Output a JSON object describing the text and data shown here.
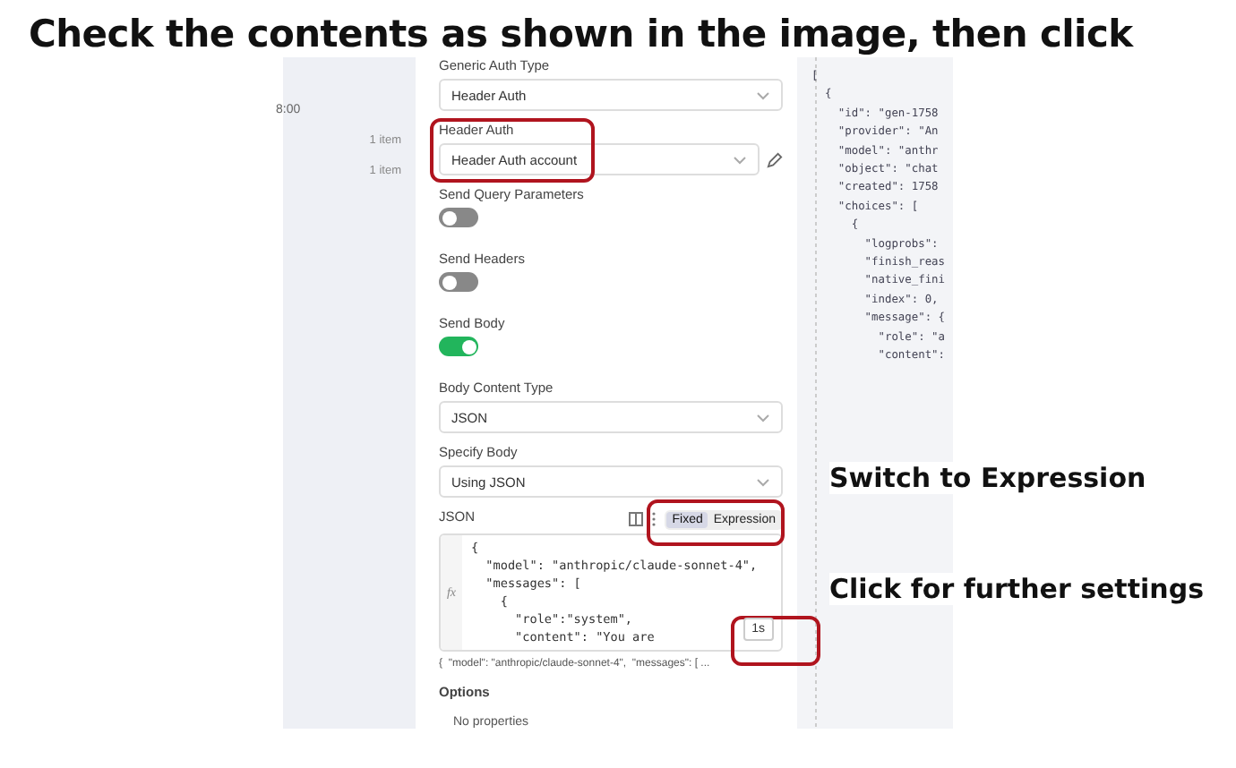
{
  "heading": "Check the contents as shown in the image, then click",
  "left_column": {
    "time": "8:00",
    "items": [
      "1 item",
      "1 item"
    ]
  },
  "fields": [
    {
      "kind": "select",
      "label": "Generic Auth Type",
      "value": "Header Auth"
    },
    {
      "kind": "credential",
      "label": "Header Auth",
      "value": "Header Auth account"
    },
    {
      "kind": "toggle",
      "label": "Send Query Parameters",
      "checked": false
    },
    {
      "kind": "toggle",
      "label": "Send Headers",
      "checked": false
    },
    {
      "kind": "toggle",
      "label": "Send Body",
      "checked": true
    },
    {
      "kind": "select",
      "label": "Body Content Type",
      "value": "JSON"
    },
    {
      "kind": "select",
      "label": "Specify Body",
      "value": "Using JSON"
    }
  ],
  "json_field": {
    "label": "JSON",
    "modes": [
      {
        "label": "Fixed",
        "selected": true
      },
      {
        "label": "Expression",
        "selected": false
      }
    ],
    "gutter": "fx",
    "lines": [
      "{",
      "  \"model\": \"anthropic/claude-sonnet-4\",",
      "  \"messages\": [",
      "    {",
      "      \"role\":\"system\",",
      "      \"content\": \"You are"
    ],
    "settings_button": "1s",
    "preview": "{  \"model\": \"anthropic/claude-sonnet-4\",  \"messages\": [ ..."
  },
  "options": {
    "label": "Options",
    "empty": "No properties"
  },
  "output_lines": [
    "[",
    "  {",
    "    \"id\": \"gen-1758",
    "    \"provider\": \"An",
    "    \"model\": \"anthr",
    "    \"object\": \"chat",
    "    \"created\": 1758",
    "    \"choices\": [",
    "      {",
    "        \"logprobs\":",
    "        \"finish_reas",
    "        \"native_fini",
    "        \"index\": 0,",
    "        \"message\": {",
    "          \"role\": \"a",
    "          \"content\":"
  ],
  "annotations": [
    "Switch to Expression",
    "Click for further settings"
  ]
}
